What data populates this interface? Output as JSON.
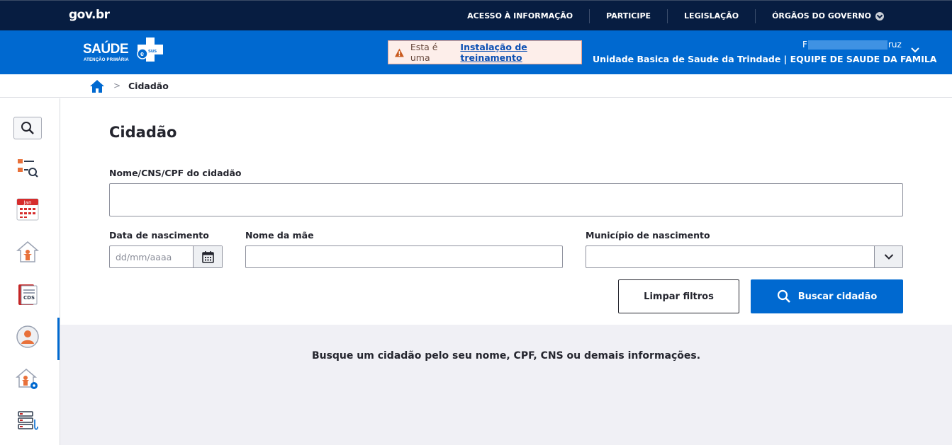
{
  "gov": {
    "logo": "gov.br",
    "links": [
      "ACESSO À INFORMAÇÃO",
      "PARTICIPE",
      "LEGISLAÇÃO",
      "ÓRGÃOS DO GOVERNO"
    ]
  },
  "header": {
    "logo_title": "SAÚDE",
    "logo_subtitle": "ATENÇÃO PRIMÁRIA",
    "logo_badge": "sus",
    "training_prefix": "Esta é uma",
    "training_link": "Instalação de treinamento",
    "user_name_start": "F",
    "user_name_end": "ruz",
    "unit": "Unidade Basica de Saude da Trindade | EQUIPE DE SAUDE DA FAMILA"
  },
  "breadcrumb": {
    "current": "Cidadão",
    "separator": ">"
  },
  "rail": {
    "items": [
      "search-icon",
      "citizen-list-icon",
      "calendar-icon",
      "home-visit-icon",
      "cds-icon",
      "citizen-icon",
      "home-settings-icon",
      "records-icon"
    ],
    "calendar_month": "Jan",
    "cds_label": "CDS"
  },
  "page": {
    "title": "Cidadão",
    "search_label": "Nome/CNS/CPF do cidadão",
    "search_value": "",
    "birth_label": "Data de nascimento",
    "birth_placeholder": "dd/mm/aaaa",
    "mother_label": "Nome da mãe",
    "mother_value": "",
    "city_label": "Município de nascimento",
    "city_value": "",
    "clear_button": "Limpar filtros",
    "search_button": "Buscar cidadão",
    "empty_message": "Busque um cidadão pelo seu nome, CPF, CNS ou demais informações."
  },
  "colors": {
    "gov_bar": "#071d41",
    "primary": "#0069d0",
    "warning_bg": "#fdeeea",
    "results_bg": "#f0f0f5"
  }
}
